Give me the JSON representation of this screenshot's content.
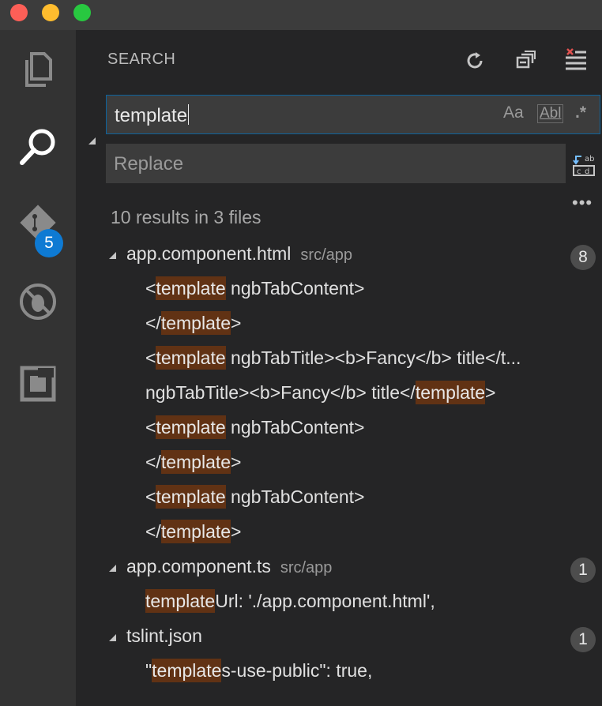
{
  "search_panel": {
    "title": "SEARCH",
    "search_value": "template",
    "option_case": "Aa",
    "option_word": "Abl",
    "option_regex": ".*",
    "replace_placeholder": "Replace",
    "summary": "10 results in 3 files"
  },
  "activity": {
    "scm_badge": "5"
  },
  "results": {
    "f1": {
      "name": "app.component.html",
      "path": "src/app",
      "count": "8",
      "m1": {
        "pre": "<",
        "hl": "template",
        "post": " ngbTabContent>"
      },
      "m2": {
        "pre": "</",
        "hl": "template",
        "post": ">"
      },
      "m3": {
        "pre": "<",
        "hl": "template",
        "post": " ngbTabTitle><b>Fancy</b> title</t..."
      },
      "m4": {
        "pre": "ngbTabTitle><b>Fancy</b> title</",
        "hl": "template",
        "post": ">"
      },
      "m5": {
        "pre": "<",
        "hl": "template",
        "post": " ngbTabContent>"
      },
      "m6": {
        "pre": "</",
        "hl": "template",
        "post": ">"
      },
      "m7": {
        "pre": "<",
        "hl": "template",
        "post": " ngbTabContent>"
      },
      "m8": {
        "pre": "</",
        "hl": "template",
        "post": ">"
      }
    },
    "f2": {
      "name": "app.component.ts",
      "path": "src/app",
      "count": "1",
      "m1": {
        "pre": "",
        "hl": "template",
        "post": "Url: './app.component.html',"
      }
    },
    "f3": {
      "name": "tslint.json",
      "path": "",
      "count": "1",
      "m1": {
        "pre": "\"",
        "hl": "template",
        "post": "s-use-public\": true,"
      }
    }
  }
}
